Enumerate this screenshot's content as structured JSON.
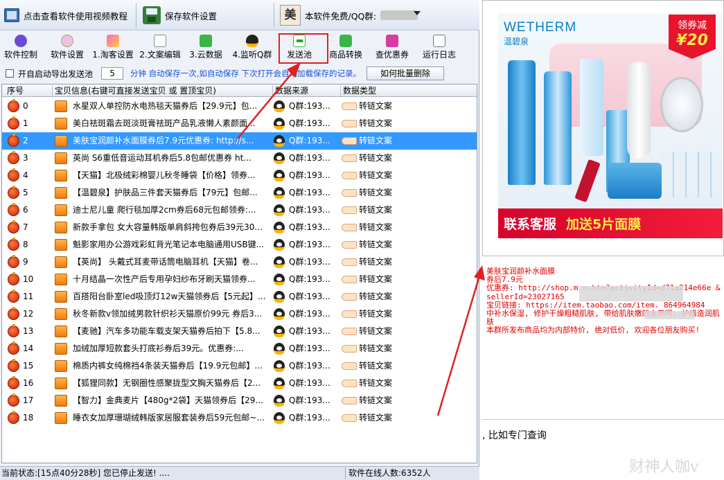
{
  "topbar": {
    "video_help": "点击查看软件使用视频教程",
    "save_settings": "保存软件设置",
    "free_label": "本软件免费/QQ群:",
    "logo_char": "美"
  },
  "toolbar": [
    "软件控制",
    "软件设置",
    "1.淘客设置",
    "2.文案编辑",
    "3.云数据",
    "4.监听Q群",
    "发送池",
    "商品转换",
    "查优惠券",
    "运行日志"
  ],
  "options": {
    "auto_export_label": "开自启动导出发送池",
    "minutes_value": "5",
    "auto_save_text": "分钟 自动保存一次,如自动保存 下次打开会自动加载保存的记录。",
    "batch_delete": "如何批量删除"
  },
  "grid": {
    "headers": [
      "序号",
      "宝贝信息(右键可直接发送宝贝 或 置顶宝贝)",
      "数据来源",
      "数据类型"
    ],
    "selected_index": 2,
    "rows": [
      {
        "no": "0",
        "info": "水星双人单控防水电热毯天猫券后【29.9元】包...",
        "source": "Q群:193...",
        "type": "转链文案"
      },
      {
        "no": "1",
        "info": "美白祛斑霜去斑淡斑膏祛斑产品乳液懒人素颜面...",
        "source": "Q群:193...",
        "type": "转链文案"
      },
      {
        "no": "2",
        "info": "美肤宝润颜补水面膜券后7.9元优惠券: http://s...",
        "source": "Q群:193...",
        "type": "转链文案"
      },
      {
        "no": "3",
        "info": "英尚 S6重低音运动耳机券后5.8包邮优惠券 ht...",
        "source": "Q群:193...",
        "type": "转链文案"
      },
      {
        "no": "4",
        "info": "【天猫】北极绒彩棉婴儿秋冬睡袋【价格】领券...",
        "source": "Q群:193...",
        "type": "转链文案"
      },
      {
        "no": "5",
        "info": "【温碧泉】护肤品三件套天猫券后【79元】包邮...",
        "source": "Q群:193...",
        "type": "转链文案"
      },
      {
        "no": "6",
        "info": "迪士尼儿童 爬行毯加厚2cm券后68元包邮领券:...",
        "source": "Q群:193...",
        "type": "转链文案"
      },
      {
        "no": "7",
        "info": "新款手拿包 女大容量韩版单肩斜挎包券后39元30...",
        "source": "Q群:193...",
        "type": "转链文案"
      },
      {
        "no": "8",
        "info": "魁影家用办公游戏彩虹背光笔记本电脑通用USB键...",
        "source": "Q群:193...",
        "type": "转链文案"
      },
      {
        "no": "9",
        "info": "【英尚】 头戴式耳麦带话筒电脑耳机【天猫】卷...",
        "source": "Q群:193...",
        "type": "转链文案"
      },
      {
        "no": "10",
        "info": "十月结晶一次性产后专用孕妇纱布牙刷天猫领券...",
        "source": "Q群:193...",
        "type": "转链文案"
      },
      {
        "no": "11",
        "info": "百搭阳台卧室led吸顶灯12w天猫领券后【5元起】...",
        "source": "Q群:193...",
        "type": "转链文案"
      },
      {
        "no": "12",
        "info": "秋冬新款v领加绒男款针织衫天猫原价99元 券后3...",
        "source": "Q群:193...",
        "type": "转链文案"
      },
      {
        "no": "13",
        "info": "【麦驰】汽车多功能车载支架天猫券后拍下【5.8...",
        "source": "Q群:193...",
        "type": "转链文案"
      },
      {
        "no": "14",
        "info": "加绒加厚短款套头打底衫券后39元。优惠券:...",
        "source": "Q群:193...",
        "type": "转链文案"
      },
      {
        "no": "15",
        "info": "棉质内裤女纯棉裆4条装天猫券后【19.9元包邮】...",
        "source": "Q群:193...",
        "type": "转链文案"
      },
      {
        "no": "16",
        "info": "【狐狸同款】无钢圈性感聚拢型文胸天猫券后【2...",
        "source": "Q群:193...",
        "type": "转链文案"
      },
      {
        "no": "17",
        "info": "【智力】金典麦片【480g*2袋】天猫领券后【29...",
        "source": "Q群:193...",
        "type": "转链文案"
      },
      {
        "no": "18",
        "info": "睡衣女加厚珊瑚绒韩版家居服套装券后59元包邮~...",
        "source": "Q群:193...",
        "type": "转链文案"
      }
    ]
  },
  "status": {
    "left": "当前状态:[15点40分28秒] 您已停止发送! ....",
    "right": "软件在线人数:6352人"
  },
  "promo": {
    "brand": "WETHERM",
    "brand_cn": "温碧泉",
    "coupon_label": "领券减",
    "coupon_amount": "¥20",
    "banner_left": "联系客服",
    "banner_right": "加送5片面膜"
  },
  "message": [
    "美肤宝润颜补水面膜",
    "券后7.9元",
    "优惠券: http://shop.m                        n.htm?activityId=d71a214e66e                      &sellerId=23027165",
    "宝贝链接: https://item.taobao.com/item.        864964984",
    "中补水保湿, 修护干燥粗糙肌肤, 带给肌肤嫩的水养呵, 护络造润肌肤",
    "本群所发布商品均为内部特价, 绝对低价, 欢迎各位朋友购买!"
  ],
  "bottom_text": ", 比如专门查询",
  "watermark": "财神人咖v",
  "colors": {
    "selection": "#3399ff",
    "link_text": "#1a4fd6",
    "message_red": "#e00000",
    "annotation_red": "#e02020"
  }
}
